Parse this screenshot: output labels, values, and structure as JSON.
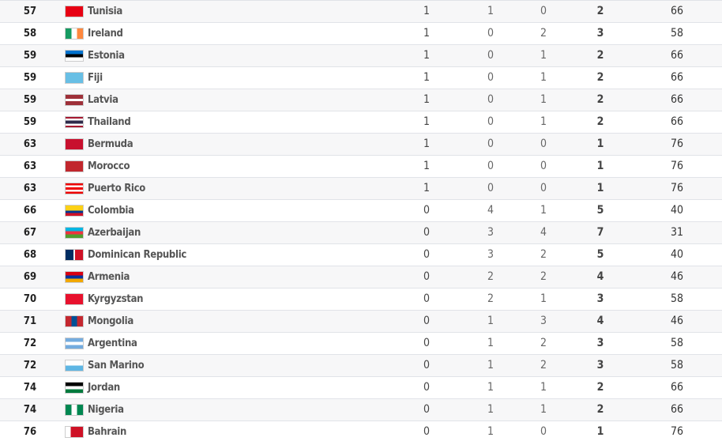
{
  "medal_table": {
    "rows": [
      {
        "rank": "57",
        "country": "Tunisia",
        "gold": "1",
        "silver": "1",
        "bronze": "0",
        "total": "2",
        "rank_by_total": "66",
        "flag": "linear-gradient(#e70013,#e70013)"
      },
      {
        "rank": "58",
        "country": "Ireland",
        "gold": "1",
        "silver": "0",
        "bronze": "2",
        "total": "3",
        "rank_by_total": "58",
        "flag": "linear-gradient(90deg,#169b62 33%,#fff 33% 66%,#ff883e 66%)"
      },
      {
        "rank": "59",
        "country": "Estonia",
        "gold": "1",
        "silver": "0",
        "bronze": "1",
        "total": "2",
        "rank_by_total": "66",
        "flag": "linear-gradient(#0072ce 33%,#000 33% 66%,#fff 66%)"
      },
      {
        "rank": "59",
        "country": "Fiji",
        "gold": "1",
        "silver": "0",
        "bronze": "1",
        "total": "2",
        "rank_by_total": "66",
        "flag": "linear-gradient(#68bfe5,#68bfe5)"
      },
      {
        "rank": "59",
        "country": "Latvia",
        "gold": "1",
        "silver": "0",
        "bronze": "1",
        "total": "2",
        "rank_by_total": "66",
        "flag": "linear-gradient(#9e3039 40%,#fff 40% 60%,#9e3039 60%)"
      },
      {
        "rank": "59",
        "country": "Thailand",
        "gold": "1",
        "silver": "0",
        "bronze": "1",
        "total": "2",
        "rank_by_total": "66",
        "flag": "linear-gradient(#a51931 17%,#fff 17% 33%,#2d2a4a 33% 67%,#fff 67% 83%,#a51931 83%)"
      },
      {
        "rank": "63",
        "country": "Bermuda",
        "gold": "1",
        "silver": "0",
        "bronze": "0",
        "total": "1",
        "rank_by_total": "76",
        "flag": "linear-gradient(#c8102e,#c8102e)"
      },
      {
        "rank": "63",
        "country": "Morocco",
        "gold": "1",
        "silver": "0",
        "bronze": "0",
        "total": "1",
        "rank_by_total": "76",
        "flag": "linear-gradient(#c1272d,#c1272d)"
      },
      {
        "rank": "63",
        "country": "Puerto Rico",
        "gold": "1",
        "silver": "0",
        "bronze": "0",
        "total": "1",
        "rank_by_total": "76",
        "flag": "linear-gradient(#ed0000 20%,#fff 20% 40%,#ed0000 40% 60%,#fff 60% 80%,#ed0000 80%)"
      },
      {
        "rank": "66",
        "country": "Colombia",
        "gold": "0",
        "silver": "4",
        "bronze": "1",
        "total": "5",
        "rank_by_total": "40",
        "flag": "linear-gradient(#fcd116 50%,#003893 50% 75%,#ce1126 75%)"
      },
      {
        "rank": "67",
        "country": "Azerbaijan",
        "gold": "0",
        "silver": "3",
        "bronze": "4",
        "total": "7",
        "rank_by_total": "31",
        "flag": "linear-gradient(#00b5e2 33%,#ef3340 33% 66%,#509e2f 66%)"
      },
      {
        "rank": "68",
        "country": "Dominican Republic",
        "gold": "0",
        "silver": "3",
        "bronze": "2",
        "total": "5",
        "rank_by_total": "40",
        "flag": "linear-gradient(90deg,#002d62 45%,#fff 45% 55%,#ce1126 55%)"
      },
      {
        "rank": "69",
        "country": "Armenia",
        "gold": "0",
        "silver": "2",
        "bronze": "2",
        "total": "4",
        "rank_by_total": "46",
        "flag": "linear-gradient(#d90012 33%,#0033a0 33% 66%,#f2a800 66%)"
      },
      {
        "rank": "70",
        "country": "Kyrgyzstan",
        "gold": "0",
        "silver": "2",
        "bronze": "1",
        "total": "3",
        "rank_by_total": "58",
        "flag": "linear-gradient(#e8112d,#e8112d)"
      },
      {
        "rank": "71",
        "country": "Mongolia",
        "gold": "0",
        "silver": "1",
        "bronze": "3",
        "total": "4",
        "rank_by_total": "46",
        "flag": "linear-gradient(90deg,#c4272f 33%,#015197 33% 66%,#c4272f 66%)"
      },
      {
        "rank": "72",
        "country": "Argentina",
        "gold": "0",
        "silver": "1",
        "bronze": "2",
        "total": "3",
        "rank_by_total": "58",
        "flag": "linear-gradient(#74acdf 33%,#fff 33% 66%,#74acdf 66%)"
      },
      {
        "rank": "72",
        "country": "San Marino",
        "gold": "0",
        "silver": "1",
        "bronze": "2",
        "total": "3",
        "rank_by_total": "58",
        "flag": "linear-gradient(#fff 50%,#5eb6e4 50%)"
      },
      {
        "rank": "74",
        "country": "Jordan",
        "gold": "0",
        "silver": "1",
        "bronze": "1",
        "total": "2",
        "rank_by_total": "66",
        "flag": "linear-gradient(#000 33%,#fff 33% 66%,#007a3d 66%)"
      },
      {
        "rank": "74",
        "country": "Nigeria",
        "gold": "0",
        "silver": "1",
        "bronze": "1",
        "total": "2",
        "rank_by_total": "66",
        "flag": "linear-gradient(90deg,#008751 33%,#fff 33% 66%,#008751 66%)"
      },
      {
        "rank": "76",
        "country": "Bahrain",
        "gold": "0",
        "silver": "1",
        "bronze": "0",
        "total": "1",
        "rank_by_total": "76",
        "flag": "linear-gradient(90deg,#fff 30%,#ce1126 30%)"
      }
    ]
  }
}
